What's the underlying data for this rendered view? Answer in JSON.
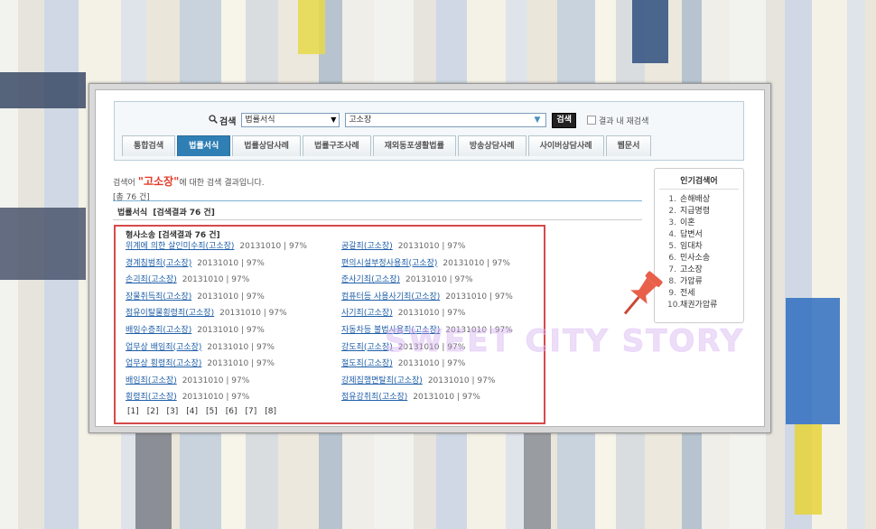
{
  "search": {
    "label": "검색",
    "category_selected": "법률서식",
    "query_value": "고소장",
    "button_label": "검색",
    "recheck_label": "결과 내 재검색"
  },
  "tabs": [
    {
      "label": "통합검색"
    },
    {
      "label": "법률서식"
    },
    {
      "label": "법률상담사례"
    },
    {
      "label": "법률구조사례"
    },
    {
      "label": "재외동포생활법률"
    },
    {
      "label": "방송상담사례"
    },
    {
      "label": "사이버상담사례"
    },
    {
      "label": "웹문서"
    }
  ],
  "results": {
    "msg_prefix": "검색어",
    "keyword": "\"고소장\"",
    "msg_suffix": "에 대한 검색 결과입니다.",
    "total": "[총 76 건]",
    "section_title": "법률서식  [검색결과 76 건]",
    "category_title": "형사소송 [검색결과 76 건]",
    "left_items": [
      {
        "title": "위계에 의한 살인미수죄(고소장)",
        "meta": "20131010 | 97%"
      },
      {
        "title": "경계침범죄(고소장)",
        "meta": "20131010 | 97%"
      },
      {
        "title": "손괴죄(고소장)",
        "meta": "20131010 | 97%"
      },
      {
        "title": "장물취득죄(고소장)",
        "meta": "20131010 | 97%"
      },
      {
        "title": "점유이탈물횡령죄(고소장)",
        "meta": "20131010 | 97%"
      },
      {
        "title": "배임수증죄(고소장)",
        "meta": "20131010 | 97%"
      },
      {
        "title": "업무상 배임죄(고소장)",
        "meta": "20131010 | 97%"
      },
      {
        "title": "업무상 횡령죄(고소장)",
        "meta": "20131010 | 97%"
      },
      {
        "title": "배임죄(고소장)",
        "meta": "20131010 | 97%"
      },
      {
        "title": "횡령죄(고소장)",
        "meta": "20131010 | 97%"
      }
    ],
    "right_items": [
      {
        "title": "공갈죄(고소장)",
        "meta": "20131010 | 97%"
      },
      {
        "title": "편의시설부정사용죄(고소장)",
        "meta": "20131010 | 97%"
      },
      {
        "title": "준사기죄(고소장)",
        "meta": "20131010 | 97%"
      },
      {
        "title": "컴퓨터등 사용사기죄(고소장)",
        "meta": "20131010 | 97%"
      },
      {
        "title": "사기죄(고소장)",
        "meta": "20131010 | 97%"
      },
      {
        "title": "자동차등 불법사용죄(고소장)",
        "meta": "20131010 | 97%"
      },
      {
        "title": "강도죄(고소장)",
        "meta": "20131010 | 97%"
      },
      {
        "title": "절도죄(고소장)",
        "meta": "20131010 | 97%"
      },
      {
        "title": "강제집행면탈죄(고소장)",
        "meta": "20131010 | 97%"
      },
      {
        "title": "점유강취죄(고소장)",
        "meta": "20131010 | 97%"
      }
    ],
    "pages": [
      "[1]",
      "[2]",
      "[3]",
      "[4]",
      "[5]",
      "[6]",
      "[7]",
      "[8]"
    ]
  },
  "popular": {
    "title": "인기검색어",
    "items": [
      {
        "n": "1.",
        "label": "손해배상"
      },
      {
        "n": "2.",
        "label": "지급명령"
      },
      {
        "n": "3.",
        "label": "이혼"
      },
      {
        "n": "4.",
        "label": "답변서"
      },
      {
        "n": "5.",
        "label": "임대차"
      },
      {
        "n": "6.",
        "label": "민사소송"
      },
      {
        "n": "7.",
        "label": "고소장"
      },
      {
        "n": "8.",
        "label": "가압류"
      },
      {
        "n": "9.",
        "label": "전세"
      },
      {
        "n": "10.",
        "label": "채권가압류"
      }
    ]
  },
  "watermark": "SWEET CITY STORY",
  "colors": {
    "active_tab": "#2f7fb4",
    "link": "#1f5fa8",
    "keyword": "#e23a26",
    "highlight_box": "#d64a4a",
    "pin": "#e8604a"
  }
}
